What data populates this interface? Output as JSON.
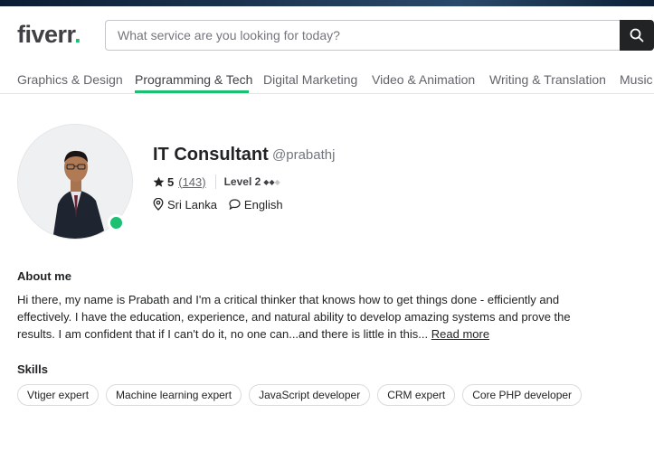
{
  "header": {
    "logo_text": "fiverr",
    "logo_dot": ".",
    "search_placeholder": "What service are you looking for today?"
  },
  "nav": {
    "items": [
      {
        "label": "Graphics & Design"
      },
      {
        "label": "Programming & Tech",
        "active": true
      },
      {
        "label": "Digital Marketing"
      },
      {
        "label": "Video & Animation"
      },
      {
        "label": "Writing & Translation"
      },
      {
        "label": "Music"
      }
    ]
  },
  "profile": {
    "title": "IT Consultant",
    "handle": "@prabathj",
    "rating": "5",
    "review_count": "(143)",
    "level": "Level 2",
    "location": "Sri Lanka",
    "language": "English",
    "online": true
  },
  "about": {
    "heading": "About me",
    "text": "Hi there, my name is Prabath and I'm a critical thinker that knows how to get things done - efficiently and effectively. I have the education, experience, and natural ability to develop amazing systems and prove the results. I am confident that if I can't do it, no one can...and there is little in this...",
    "read_more": "Read more"
  },
  "skills": {
    "heading": "Skills",
    "items": [
      "Vtiger expert",
      "Machine learning expert",
      "JavaScript developer",
      "CRM expert",
      "Core PHP developer"
    ]
  },
  "colors": {
    "brand_green": "#1dbf73",
    "dark": "#222325",
    "muted": "#74767e"
  },
  "icons": [
    "search-icon",
    "star-icon",
    "location-pin-icon",
    "chat-bubble-icon",
    "diamond-icon"
  ]
}
